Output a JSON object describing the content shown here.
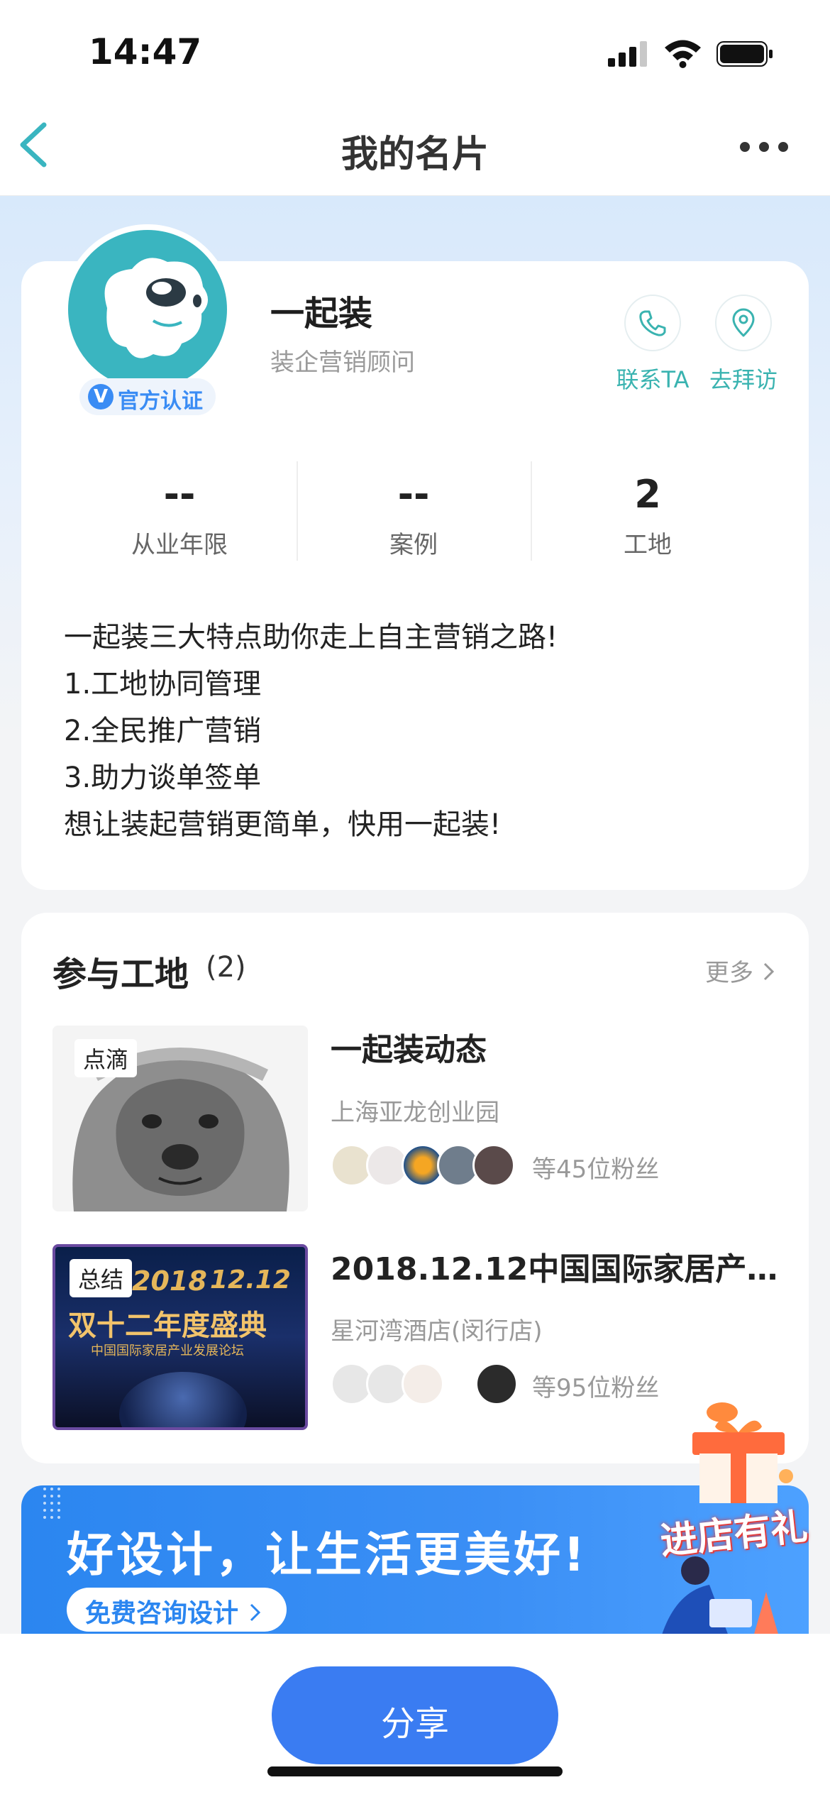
{
  "status_bar": {
    "time": "14:47"
  },
  "nav": {
    "title": "我的名片"
  },
  "profile": {
    "name": "一起装",
    "role": "装企营销顾问",
    "badge": "官方认证",
    "actions": [
      {
        "label": "联系TA",
        "icon": "phone-icon"
      },
      {
        "label": "去拜访",
        "icon": "location-pin-icon"
      }
    ],
    "stats": [
      {
        "value": "--",
        "label": "从业年限"
      },
      {
        "value": "--",
        "label": "案例"
      },
      {
        "value": "2",
        "label": "工地"
      }
    ],
    "description": [
      "一起装三大特点助你走上自主营销之路!",
      "1.工地协同管理",
      "2.全民推广营销",
      "3.助力谈单签单",
      "想让装起营销更简单，快用一起装!"
    ]
  },
  "sites": {
    "title": "参与工地",
    "count": "(2)",
    "more": "更多",
    "items": [
      {
        "tag": "点滴",
        "title": "一起装动态",
        "location": "上海亚龙创业园",
        "fans": "等45位粉丝"
      },
      {
        "tag": "总结",
        "title": "2018.12.12中国国际家居产…",
        "location": "星河湾酒店(闵行店)",
        "fans": "等95位粉丝",
        "image_text": {
          "year": "2018",
          "date": "12.12",
          "headline": "双十二年度盛典",
          "sub": "中国国际家居产业发展论坛"
        }
      }
    ]
  },
  "banner": {
    "title": "好设计，让生活更美好!",
    "button": "免费咨询设计",
    "gift": "进店有礼"
  },
  "footer": {
    "share": "分享"
  },
  "colors": {
    "accent": "#3ab5c0",
    "primary": "#3a7cf2",
    "banner": "#2b86f0"
  }
}
